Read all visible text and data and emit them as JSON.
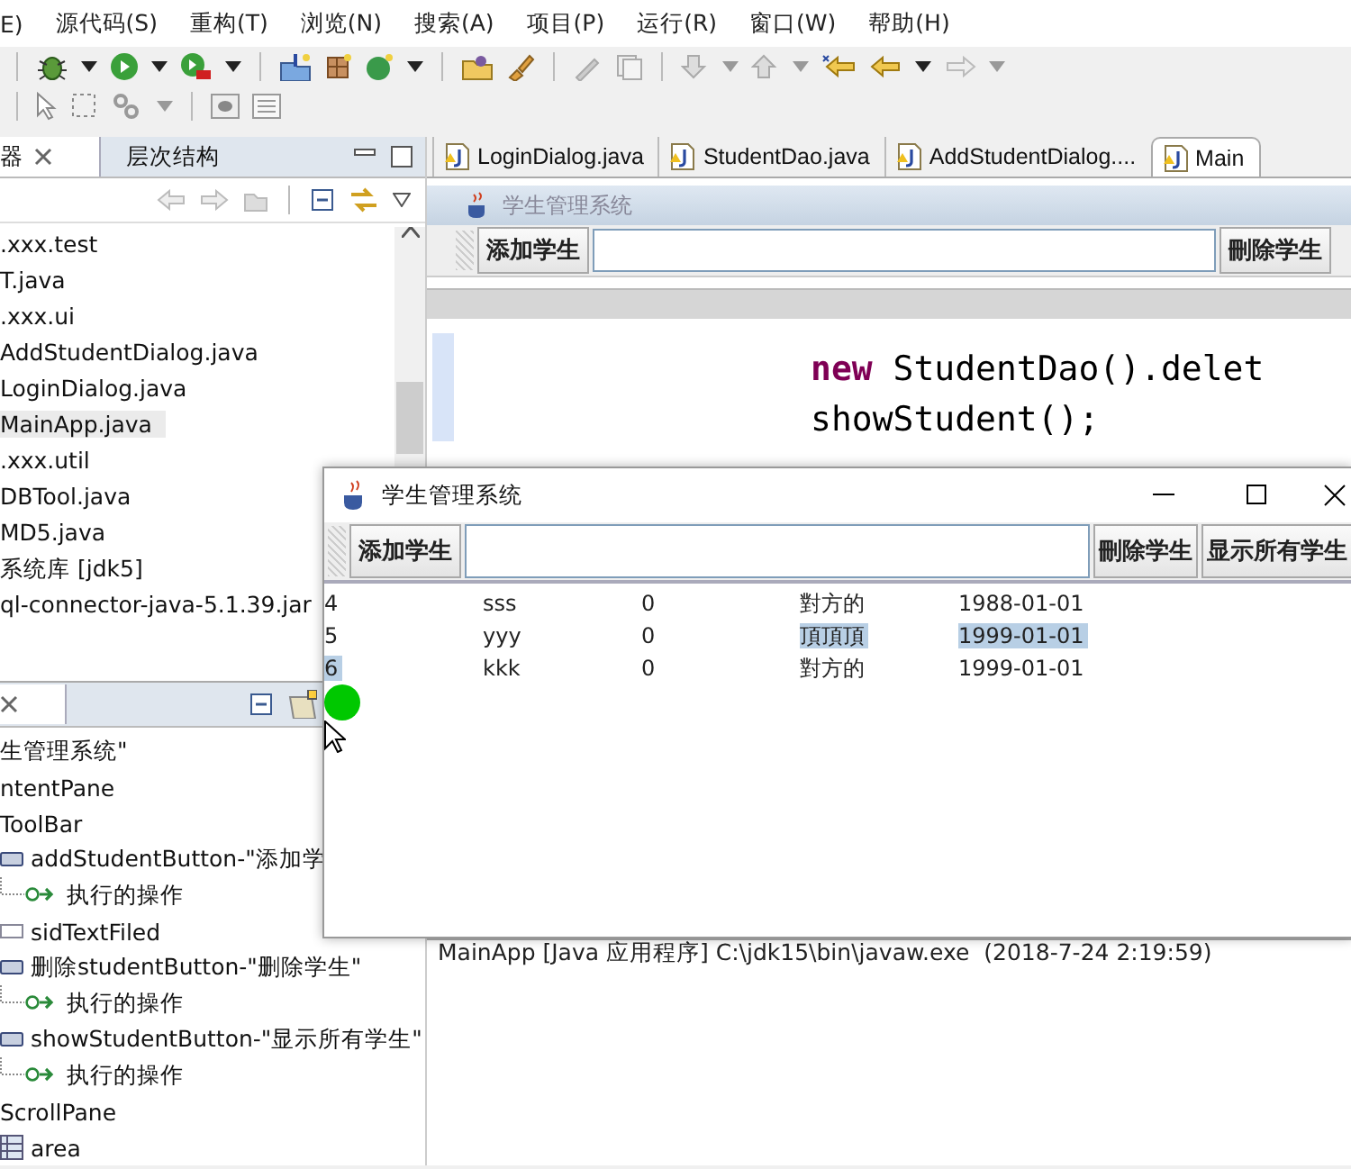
{
  "menu": [
    {
      "label": "E)"
    },
    {
      "label": "源代码(S)"
    },
    {
      "label": "重构(T)"
    },
    {
      "label": "浏览(N)"
    },
    {
      "label": "搜索(A)"
    },
    {
      "label": "项目(P)"
    },
    {
      "label": "运行(R)"
    },
    {
      "label": "窗口(W)"
    },
    {
      "label": "帮助(H)"
    }
  ],
  "package_explorer": {
    "tabs": [
      {
        "label": "器",
        "selected": true
      },
      {
        "label": "层次结构",
        "selected": false
      }
    ],
    "items": [
      {
        "label": ".xxx.test",
        "selected": false
      },
      {
        "label": "T.java",
        "selected": false
      },
      {
        "label": ".xxx.ui",
        "selected": false
      },
      {
        "label": "AddStudentDialog.java",
        "selected": false
      },
      {
        "label": "LoginDialog.java",
        "selected": false
      },
      {
        "label": "MainApp.java",
        "selected": true
      },
      {
        "label": ".xxx.util",
        "selected": false
      },
      {
        "label": "DBTool.java",
        "selected": false
      },
      {
        "label": "MD5.java",
        "selected": false
      },
      {
        "label": "系统库 [jdk5]",
        "selected": false
      },
      {
        "label": "ql-connector-java-5.1.39.jar",
        "selected": false
      }
    ]
  },
  "outline": {
    "items": [
      {
        "label": "生管理系统\"",
        "children": [
          {
            "label": "ntentPane",
            "children": [
              {
                "label": "ToolBar",
                "children": [
                  {
                    "label": "addStudentButton-\"添加学",
                    "kind": "button",
                    "children": [
                      {
                        "label": "执行的操作",
                        "kind": "action"
                      }
                    ]
                  },
                  {
                    "label": "sidTextFiled",
                    "kind": "text-field"
                  },
                  {
                    "label": "删除studentButton-\"删除学生\"",
                    "kind": "button",
                    "children": [
                      {
                        "label": "执行的操作",
                        "kind": "action"
                      }
                    ]
                  },
                  {
                    "label": "showStudentButton-\"显示所有学生\"",
                    "kind": "button",
                    "children": [
                      {
                        "label": "执行的操作",
                        "kind": "action"
                      }
                    ]
                  }
                ]
              },
              {
                "label": "ScrollPane",
                "children": [
                  {
                    "label": "area",
                    "kind": "table"
                  }
                ]
              }
            ]
          }
        ]
      }
    ]
  },
  "editor": {
    "tabs": [
      {
        "label": "LoginDialog.java",
        "selected": false
      },
      {
        "label": "StudentDao.java",
        "selected": false
      },
      {
        "label": "AddStudentDialog....",
        "selected": false
      },
      {
        "label": "Main",
        "selected": true
      }
    ],
    "preview": {
      "title": "学生管理系统",
      "add_button": "添加学生",
      "delete_button": "刪除学生"
    },
    "code": [
      [
        {
          "text": "new",
          "kind": "keyword"
        },
        {
          "text": " StudentDao().delet",
          "kind": "plain"
        }
      ],
      [
        {
          "text": "showStudent();",
          "kind": "plain"
        }
      ]
    ],
    "console_header": "MainApp [Java 应用程序] C:\\jdk15\\bin\\javaw.exe  (2018-7-24 2:19:59)"
  },
  "dialog": {
    "title": "学生管理系统",
    "add_button": "添加学生",
    "delete_button": "刪除学生",
    "show_button": "显示所有学生",
    "rows": [
      [
        {
          "text": "4",
          "selected": false
        },
        {
          "text": "sss",
          "selected": false
        },
        {
          "text": "0",
          "selected": false
        },
        {
          "text": "對方的",
          "selected": false
        },
        {
          "text": "1988-01-01",
          "selected": false
        }
      ],
      [
        {
          "text": "5",
          "selected": false
        },
        {
          "text": "yyy",
          "selected": false
        },
        {
          "text": "0",
          "selected": false
        },
        {
          "text": "頂頂頂",
          "selected": true
        },
        {
          "text": "1999-01-01",
          "selected": true
        }
      ],
      [
        {
          "text": "6",
          "selected": true
        },
        {
          "text": "kkk",
          "selected": false
        },
        {
          "text": "0",
          "selected": false
        },
        {
          "text": "對方的",
          "selected": false
        },
        {
          "text": "1999-01-01",
          "selected": false
        }
      ]
    ]
  }
}
